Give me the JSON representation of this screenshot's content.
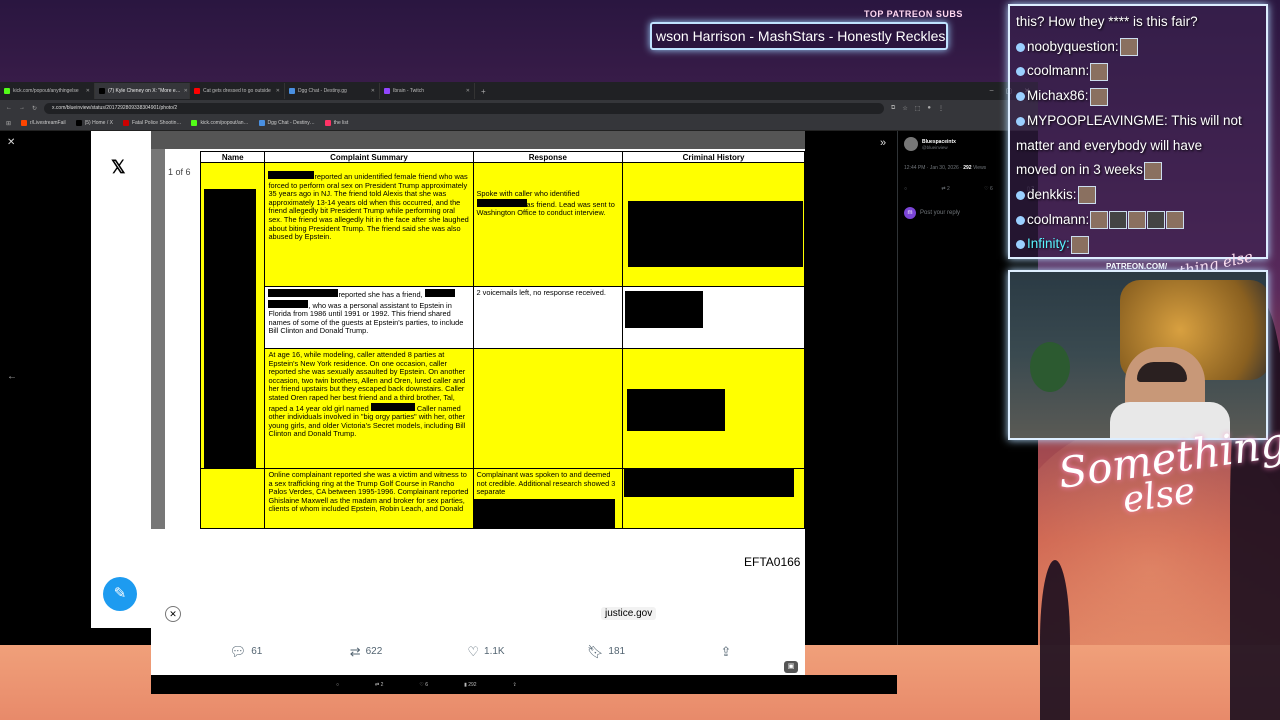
{
  "overlay": {
    "patreon_label": "TOP PATREON SUBS",
    "ticker_text": "wson Harrison - MashStars - Honestly Reckless",
    "patreon_url": "PATREON.COM/",
    "script_top": "Anything else",
    "logo_line1": "Something",
    "logo_line2": "else"
  },
  "browser": {
    "tabs": [
      {
        "label": "kick.com/popout/anythingelse",
        "color": "#53fc18",
        "active": false
      },
      {
        "label": "(7) Kyle Cheney on X: \"More e…",
        "color": "#000000",
        "active": true
      },
      {
        "label": "Cat gets dressed to go outside",
        "color": "#ff0000",
        "active": false
      },
      {
        "label": "Dgg Chat - Destiny.gg",
        "color": "#4a90e2",
        "active": false
      },
      {
        "label": "Ibrain - Twitch",
        "color": "#9146ff",
        "active": false
      }
    ],
    "new_tab": "+",
    "window_controls": [
      "–",
      "▢",
      "✕"
    ],
    "url": "x.com/blueinview/status/2017292809338304901/photo/2",
    "bookmarks": [
      {
        "label": "r/LivestreamFail",
        "color": "#ff4500"
      },
      {
        "label": "(5) Home / X",
        "color": "#000000"
      },
      {
        "label": "Fatal Police Shootin…",
        "color": "#cc0000"
      },
      {
        "label": "kick.com/popout/an…",
        "color": "#53fc18"
      },
      {
        "label": "Dgg Chat - Destiny…",
        "color": "#4a90e2"
      },
      {
        "label": "the list",
        "color": "#ff3366"
      }
    ]
  },
  "photo": {
    "page_indicator": "1 of 6",
    "efta": "EFTA0166",
    "source": "justice.gov",
    "headers": [
      "Name",
      "Complaint Summary",
      "Response",
      "Criminal History"
    ],
    "rows": [
      {
        "summary": "reported an unidentified female friend who was forced to perform oral sex on President Trump approximately 35 years ago in NJ. The friend told Alexis that she was approximately 13-14 years old when this occurred, and the friend allegedly bit President Trump while performing oral sex. The friend was allegedly hit in the face after she laughed about biting President Trump. The friend said she was also abused by Epstein.",
        "response_a": "Spoke with caller who identified",
        "response_b": "as friend. Lead was sent to Washington Office to conduct interview."
      },
      {
        "summary_a": "reported she has a friend,",
        "summary_b": ", who was a personal assistant to Epstein in Florida from 1986 until 1991 or 1992. This friend shared names of some of the guests at Epstein's parties, to include Bill Clinton and Donald Trump.",
        "response": "2 voicemails left, no response received."
      },
      {
        "summary_a": "At age 16, while modeling, caller attended 8 parties at Epstein's New York residence. On one occasion, caller reported she was sexually assaulted by Epstein. On another occasion, two twin brothers, Allen and Oren, lured caller and her friend upstairs but they escaped back downstairs. Caller stated Oren raped her best friend and a third brother, Tal, raped a 14 year old girl named",
        "summary_b": "Caller named other individuals involved in \"big orgy parties\" with her, other young girls, and older Victoria's Secret models, including Bill Clinton and Donald Trump.",
        "response": ""
      },
      {
        "summary": "Online complainant reported she was a victim and witness to a sex trafficking ring at the Trump Golf Course in Rancho Palos Verdes, CA between 1995-1996. Complainant reported Ghislaine Maxwell as the madam and broker for sex parties, clients of whom included Epstein, Robin Leach, and Donald",
        "response": "Complainant was spoken to and deemed not credible. Additional research showed 3 separate"
      }
    ]
  },
  "actions": {
    "replies": "61",
    "reposts": "622",
    "likes": "1.1K",
    "bookmarks": "181"
  },
  "tweet": {
    "name": "Bluespaceintx",
    "handle": "@blueinview",
    "meta": "12:44 PM · Jan 30, 2026 · ",
    "views": "292",
    "views_label": "Views",
    "reply_placeholder": "Post your reply",
    "reply_avatar": "m",
    "acts": [
      "",
      "2",
      "6",
      "2"
    ]
  },
  "bottom_bar": [
    "",
    "2",
    "6",
    "292",
    ""
  ],
  "chat": [
    {
      "user": "",
      "text": "this? How they **** is this fair?",
      "emotes": 0,
      "badge": false,
      "cyan": false
    },
    {
      "user": "noobyquestion:",
      "text": "",
      "emotes": 1,
      "badge": true,
      "cyan": false
    },
    {
      "user": "coolmann:",
      "text": "",
      "emotes": 1,
      "badge": true,
      "cyan": false
    },
    {
      "user": "Michax86:",
      "text": "",
      "emotes": 1,
      "badge": true,
      "cyan": false
    },
    {
      "user": "MYPOOPLEAVINGME:",
      "text": " This will not",
      "emotes": 0,
      "badge": true,
      "cyan": false
    },
    {
      "user": "",
      "text": "matter and everybody will have",
      "emotes": 0,
      "badge": false,
      "cyan": false
    },
    {
      "user": "",
      "text": "moved on in 3 weeks",
      "emotes": 1,
      "badge": false,
      "cyan": false
    },
    {
      "user": "denkkis:",
      "text": "",
      "emotes": 1,
      "badge": true,
      "cyan": false
    },
    {
      "user": "coolmann:",
      "text": "",
      "emotes": 5,
      "badge": true,
      "cyan": false
    },
    {
      "user": "Infinity:",
      "text": "",
      "emotes": 1,
      "badge": true,
      "cyan": true
    }
  ]
}
